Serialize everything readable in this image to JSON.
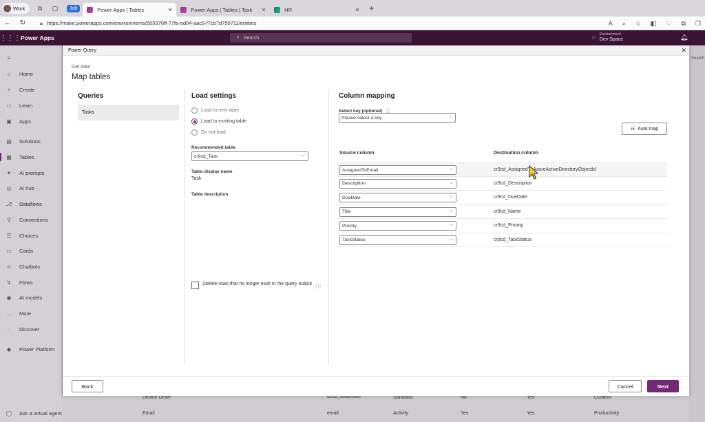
{
  "browser": {
    "profile_label": "Work",
    "badge": "Job",
    "tabs": [
      {
        "label": "Power Apps | Tables"
      },
      {
        "label": "Power Apps | Tables | Task"
      },
      {
        "label": "HR"
      }
    ],
    "url": "https://make.powerapps.com/environments/505376ff-77fa-ed04-aac9-f7cb7d750711/entities"
  },
  "app": {
    "title": "Power Apps",
    "search_placeholder": "Search",
    "env_label": "Environment",
    "env_name": "Dev Space"
  },
  "leftnav": {
    "items": [
      {
        "label": "Home"
      },
      {
        "label": "Create"
      },
      {
        "label": "Learn"
      },
      {
        "label": "Apps"
      },
      {
        "label": "Solutions"
      },
      {
        "label": "Tables"
      },
      {
        "label": "AI prompts"
      },
      {
        "label": "AI hub"
      },
      {
        "label": "Dataflows"
      },
      {
        "label": "Connections"
      },
      {
        "label": "Choices"
      },
      {
        "label": "Cards"
      },
      {
        "label": "Chatbots"
      },
      {
        "label": "Flows"
      },
      {
        "label": "AI models"
      },
      {
        "label": "More"
      },
      {
        "label": "Discover"
      },
      {
        "label": "Power Platform"
      }
    ],
    "virtual_agent": "Ask a virtual agent"
  },
  "background_rows": [
    {
      "name": "Device Order",
      "schema": "cr9cd_deviceorder",
      "type": "Standard",
      "c1": "No",
      "c2": "Yes",
      "tag": "Custom"
    },
    {
      "name": "Email",
      "schema": "email",
      "type": "Activity",
      "c1": "Yes",
      "c2": "Yes",
      "tag": "Productivity"
    }
  ],
  "background_search": "Search",
  "dialog": {
    "window_title": "Power Query",
    "breadcrumb": "Get data",
    "title": "Map tables",
    "queries": {
      "heading": "Queries",
      "items": [
        "Tasks"
      ]
    },
    "load_settings": {
      "heading": "Load settings",
      "options": [
        "Load to new table",
        "Load to existing table",
        "Do not load"
      ],
      "selected": "Load to existing table",
      "recommended_label": "Recommended table",
      "recommended_value": "cr9cd_Task",
      "display_name_label": "Table display name",
      "display_name_value": "Task",
      "description_label": "Table description",
      "delete_rows_label": "Delete rows that no longer exist in the query output"
    },
    "column_mapping": {
      "heading": "Column mapping",
      "select_key_label": "Select key (optional)",
      "select_key_placeholder": "Please select a key",
      "auto_map": "Auto map",
      "source_header": "Source column",
      "dest_header": "Destination column",
      "rows": [
        {
          "source": "AssignedToEmail",
          "dest": "cr9cd_AssignedToAzureActiveDirectoryObjectId"
        },
        {
          "source": "Description",
          "dest": "cr9cd_Description"
        },
        {
          "source": "DueDate",
          "dest": "cr9cd_DueDate"
        },
        {
          "source": "Title",
          "dest": "cr9cd_Name"
        },
        {
          "source": "Priority",
          "dest": "cr9cd_Priority"
        },
        {
          "source": "TaskStatus",
          "dest": "cr9cd_TaskStatus"
        }
      ]
    },
    "footer": {
      "back": "Back",
      "cancel": "Cancel",
      "next": "Next"
    }
  },
  "colors": {
    "accent": "#742774",
    "header_bg": "#3b1335"
  }
}
